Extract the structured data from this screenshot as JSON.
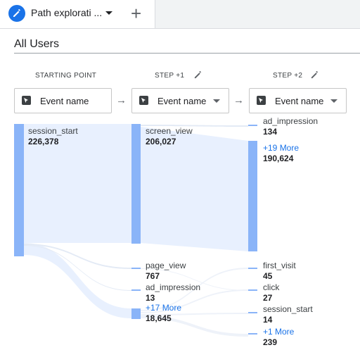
{
  "tab": {
    "label": "Path explorati ...",
    "add_label": "+"
  },
  "segment": "All Users",
  "steps": [
    {
      "header": "STARTING POINT",
      "dropdown": "Event name"
    },
    {
      "header": "STEP +1",
      "dropdown": "Event name"
    },
    {
      "header": "STEP +2",
      "dropdown": "Event name"
    }
  ],
  "nodes": {
    "start": [
      {
        "label": "session_start",
        "value": "226,378"
      }
    ],
    "step1": [
      {
        "label": "screen_view",
        "value": "206,027"
      },
      {
        "label": "page_view",
        "value": "767"
      },
      {
        "label": "ad_impression",
        "value": "13"
      },
      {
        "label": "+17 More",
        "value": "18,645"
      }
    ],
    "step2": [
      {
        "label": "ad_impression",
        "value": "134"
      },
      {
        "label": "+19 More",
        "value": "190,624"
      },
      {
        "label": "first_visit",
        "value": "45"
      },
      {
        "label": "click",
        "value": "27"
      },
      {
        "label": "session_start",
        "value": "14"
      },
      {
        "label": "+1 More",
        "value": "239"
      }
    ]
  },
  "colors": {
    "node": "#8ab4f8",
    "link": "#e8f0fe",
    "accent": "#1a73e8"
  }
}
